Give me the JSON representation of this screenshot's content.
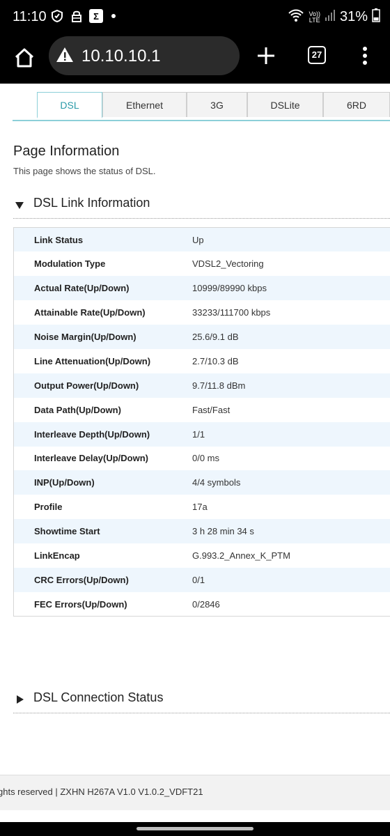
{
  "status_bar": {
    "time": "11:10",
    "battery": "31%",
    "lte_top": "Vo))",
    "lte_bottom": "LTE",
    "icons": [
      "shield-icon",
      "vpn-lock-icon",
      "sigma-app-icon",
      "notification-dot-icon",
      "wifi-icon",
      "volte-icon",
      "signal-icon"
    ]
  },
  "browser": {
    "url": "10.10.10.1",
    "tab_count": "27",
    "icons": [
      "home-icon",
      "warning-icon",
      "plus-icon",
      "tabs-icon",
      "more-vert-icon"
    ]
  },
  "tabs": [
    {
      "label": "DSL",
      "active": true
    },
    {
      "label": "Ethernet",
      "active": false
    },
    {
      "label": "3G",
      "active": false
    },
    {
      "label": "DSLite",
      "active": false
    },
    {
      "label": "6RD",
      "active": false
    }
  ],
  "page": {
    "title": "Page Information",
    "description": "This page shows the status of DSL."
  },
  "link_section": {
    "title": "DSL Link Information",
    "expanded": true,
    "rows": [
      {
        "label": "Link Status",
        "value": "Up"
      },
      {
        "label": "Modulation Type",
        "value": "VDSL2_Vectoring"
      },
      {
        "label": "Actual Rate(Up/Down)",
        "value": "10999/89990 kbps"
      },
      {
        "label": "Attainable Rate(Up/Down)",
        "value": "33233/111700 kbps"
      },
      {
        "label": "Noise Margin(Up/Down)",
        "value": "25.6/9.1 dB"
      },
      {
        "label": "Line Attenuation(Up/Down)",
        "value": "2.7/10.3 dB"
      },
      {
        "label": "Output Power(Up/Down)",
        "value": "9.7/11.8 dBm"
      },
      {
        "label": "Data Path(Up/Down)",
        "value": "Fast/Fast"
      },
      {
        "label": "Interleave Depth(Up/Down)",
        "value": "1/1"
      },
      {
        "label": "Interleave Delay(Up/Down)",
        "value": "0/0 ms"
      },
      {
        "label": "INP(Up/Down)",
        "value": "4/4 symbols"
      },
      {
        "label": "Profile",
        "value": "17a"
      },
      {
        "label": "Showtime Start",
        "value": "3 h 28 min 34 s"
      },
      {
        "label": "LinkEncap",
        "value": "G.993.2_Annex_K_PTM"
      },
      {
        "label": "CRC Errors(Up/Down)",
        "value": "0/1"
      },
      {
        "label": "FEC Errors(Up/Down)",
        "value": "0/2846"
      }
    ]
  },
  "connection_section": {
    "title": "DSL Connection Status",
    "expanded": false
  },
  "footer": {
    "text": "ghts reserved  |   ZXHN H267A V1.0 V1.0.2_VDFT21"
  },
  "colors": {
    "accent": "#2a9aa8",
    "row_alt": "#eef6fd"
  }
}
